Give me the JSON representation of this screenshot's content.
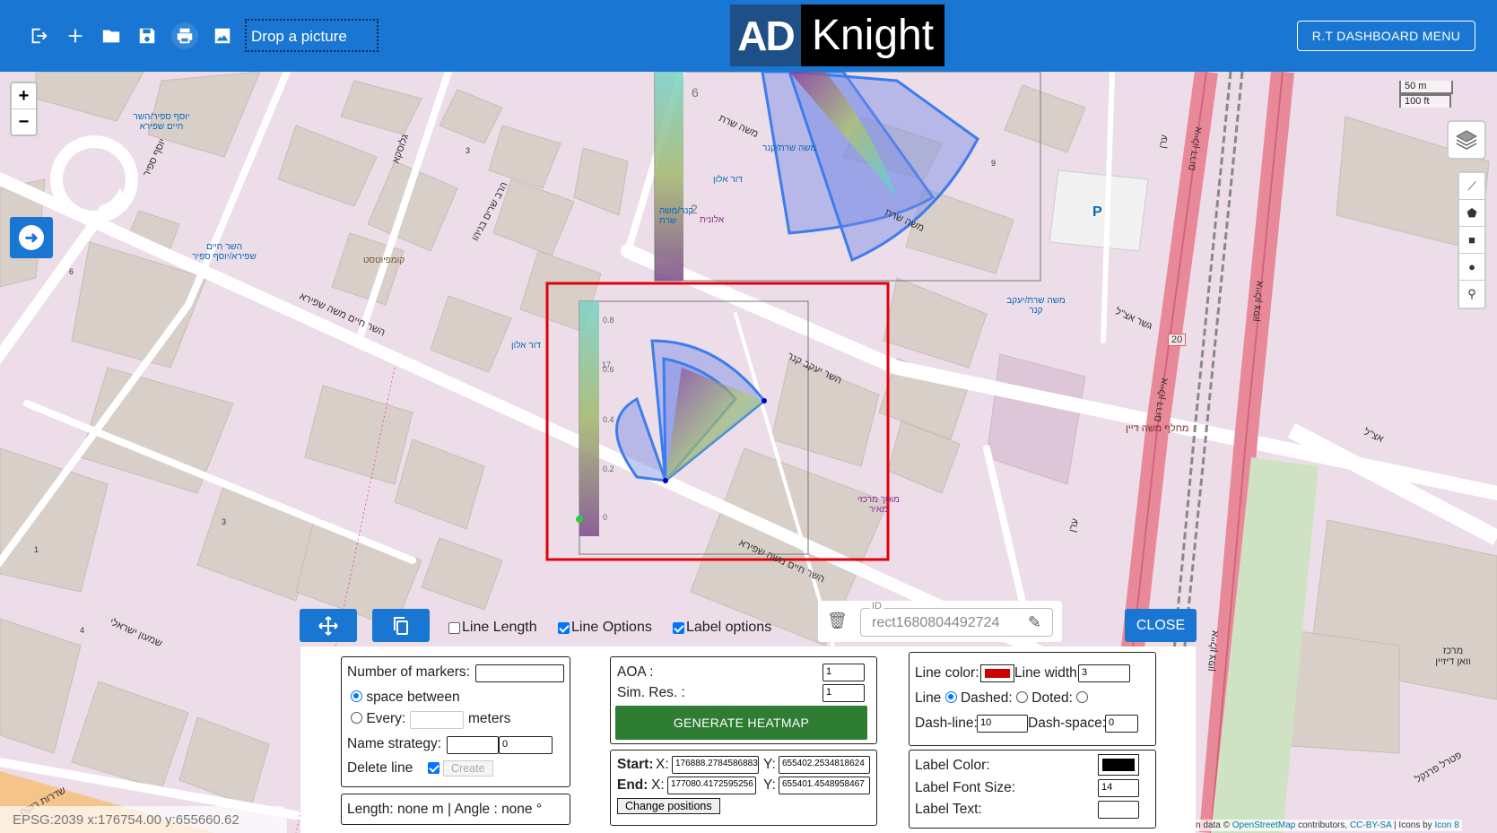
{
  "toolbar": {
    "drop_picture": "Drop a picture",
    "icons": [
      "logout-icon",
      "add-icon",
      "folder-icon",
      "save-icon",
      "print-icon",
      "image-icon"
    ]
  },
  "logo": {
    "left": "AD",
    "right": "Knight"
  },
  "header": {
    "menu_button": "R.T DASHBOARD MENU"
  },
  "map": {
    "zoom_in": "+",
    "zoom_out": "−",
    "scale_m": "50 m",
    "scale_ft": "100 ft",
    "coords": "EPSG:2039   x:176754.00   y:655660.62",
    "attribution_prefix": "n data ©",
    "attribution_osm": "OpenStreetMap",
    "attribution_mid": "contributors,",
    "attribution_license": "CC-BY-SA",
    "attribution_icons": "| Icons by",
    "attribution_icon8": "Icon 8",
    "labels": {
      "street_shapira": "השר חיים משה שפירא",
      "street_shapira2": "השר חיים משה שפירא",
      "street_yaakov": "השר יעקב קנר",
      "street_shrat": "משה שרת",
      "street_shrat2": "משה שרת",
      "street_ayalon_s": "איילון דרום",
      "street_ayalon_s2": "איילון דרום",
      "street_ayalon_n": "איילון צפון",
      "street_ayalon_n2": "איילון צפון",
      "street_eran": "ערן",
      "street_eran2": "ערן",
      "street_bridge": "גשר אצ\"ל",
      "street_etsel": "אצ\"ל",
      "street_shimon": "שמעון ישראלי",
      "street_gluska": "גלוסקא",
      "street_harav": "הרב שרים בניהו",
      "street_yosef": "יוסף ספיר",
      "bus_yosef": "יוסף ספיר/השר חיים שפירא",
      "bus_haim": "השר חיים שפירא/יוסף ספיר",
      "bus_moshe": "משה שרת/קנר",
      "bus_kaner": "קנר/משה שרת",
      "bus_shrat": "משה שרת/יעקב קנר",
      "fuel_1": "דור אלון",
      "fuel_2": "דור אלון",
      "shop": "אלונית",
      "compost": "קומפיוטסט",
      "car_dealer": "מוסך מרכזי מאיר",
      "dept": "מחלף משה דיין",
      "center": "מרכז וואן דיזיין",
      "parking": "P",
      "road_20": "20",
      "street_arlozorov": "שדרות רוקח",
      "street_peretz": "פטרל פרנקל",
      "num_1": "1",
      "num_3": "3",
      "num_4": "4",
      "num_6": "6",
      "num_9": "9",
      "num_2": "2",
      "num_3b": "3",
      "num_6b": "6"
    },
    "heatmap_ticks": [
      "0.8",
      "17",
      "0.6",
      "0.4",
      "0.2",
      "0"
    ]
  },
  "tools": {
    "line_length": "Line Length",
    "line_length_checked": false,
    "line_options": "Line Options",
    "line_options_checked": true,
    "label_options": "Label options",
    "label_options_checked": true,
    "id_legend": "ID",
    "id_value": "rect1680804492724",
    "close": "CLOSE"
  },
  "markers": {
    "number_label": "Number of markers:",
    "number_value": "",
    "space_between": "space between",
    "every": "Every:",
    "every_value": "",
    "meters": "meters",
    "name_strategy": "Name strategy:",
    "name_value": "",
    "name_num": "0",
    "delete_line": "Delete line",
    "create": "Create",
    "length": "Length: none m | Angle : none °"
  },
  "heatmap": {
    "aoa_label": "AOA :",
    "aoa_value": "1",
    "sim_label": "Sim. Res. :",
    "sim_value": "1",
    "generate": "GENERATE HEATMAP",
    "start_label": "Start:",
    "x_label": "X:",
    "y_label": "Y:",
    "start_x": "176888.2784586883",
    "start_y": "655402.2534818624",
    "end_label": "End:",
    "end_x": "177080.4172595256",
    "end_y": "655401.4548958467",
    "change_positions": "Change positions"
  },
  "line_style": {
    "color_label": "Line color:",
    "color": "#cc0000",
    "width_label": "Line width:",
    "width_value": "3",
    "line_label": "Line",
    "dashed": "Dashed:",
    "doted": "Doted:",
    "dash_line_label": "Dash-line:",
    "dash_line_value": "10",
    "dash_space_label": "Dash-space:",
    "dash_space_value": "0"
  },
  "label_style": {
    "color_label": "Label Color:",
    "color": "#000000",
    "font_size_label": "Label Font Size:",
    "font_size_value": "14",
    "text_label": "Label Text:",
    "text_value": ""
  }
}
